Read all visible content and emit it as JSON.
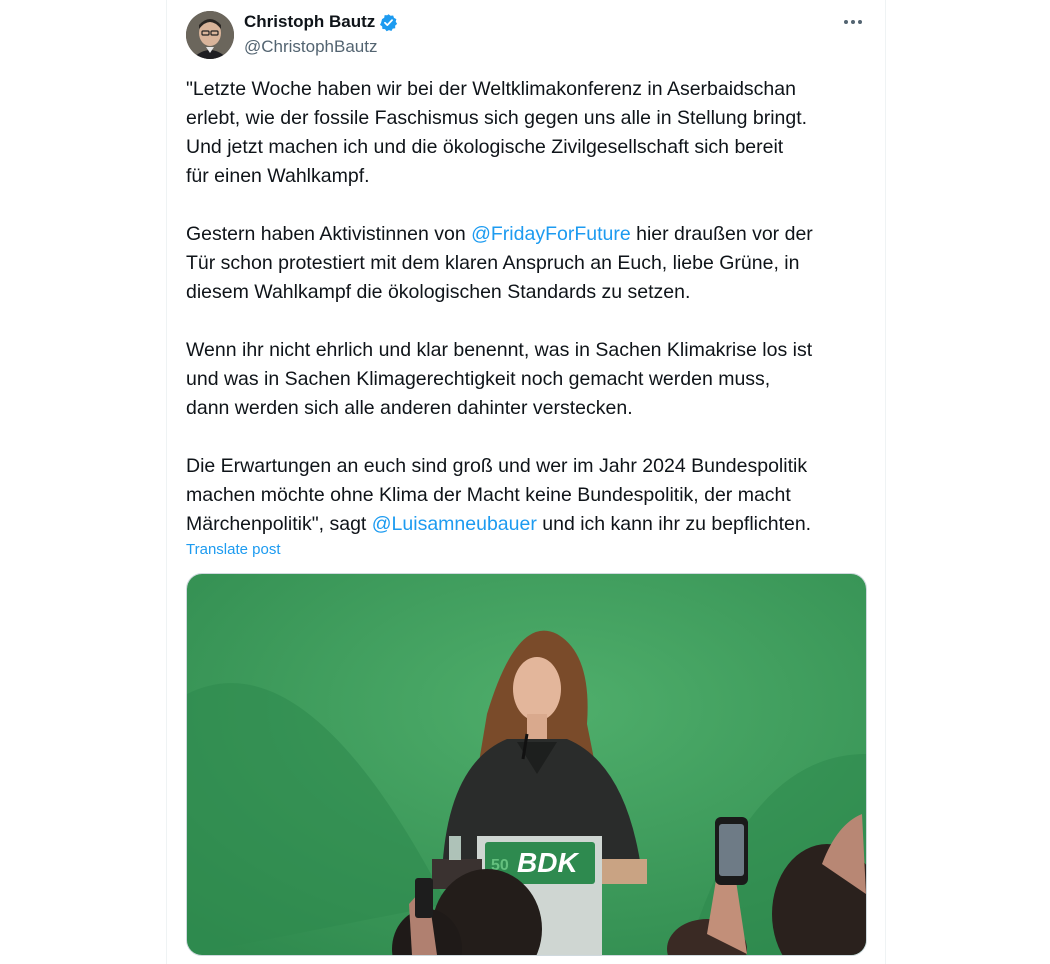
{
  "author": {
    "name": "Christoph Bautz",
    "handle": "@ChristophBautz"
  },
  "post": {
    "p1": [
      "\"Letzte Woche haben wir bei der Weltklimakonferenz in Aserbaidschan",
      "erlebt, wie der fossile Faschismus sich gegen uns alle in Stellung bringt.",
      "Und jetzt machen ich  und die ökologische Zivilgesellschaft sich bereit",
      "für einen Wahlkampf."
    ],
    "p2_line1_before": "Gestern haben Aktivistinnen von ",
    "p2_mention": "@FridayForFuture",
    "p2_line1_after": " hier  draußen vor der",
    "p2_rest": [
      "Tür schon protestiert mit dem klaren Anspruch an Euch, liebe Grüne, in",
      "diesem Wahlkampf die ökologischen Standards zu setzen."
    ],
    "p3": [
      "Wenn ihr nicht ehrlich und klar benennt, was in Sachen Klimakrise los ist",
      "und was in Sachen Klimagerechtigkeit noch gemacht werden muss,",
      "dann werden sich alle anderen dahinter verstecken."
    ],
    "p4": [
      "Die Erwartungen an euch sind groß und wer im Jahr 2024 Bundespolitik",
      "machen möchte ohne Klima der Macht keine Bundespolitik, der macht"
    ],
    "p4_last_before": "Märchenpolitik\", sagt ",
    "p4_mention": "@Luisamneubauer",
    "p4_last_after": " und ich kann ihr zu bepflichten."
  },
  "translate_label": "Translate post",
  "media": {
    "podium_text": "BDK",
    "podium_number": "50"
  },
  "colors": {
    "link": "#1d9bf0",
    "stage_green": "#3d9a5a",
    "verified": "#1d9bf0"
  }
}
